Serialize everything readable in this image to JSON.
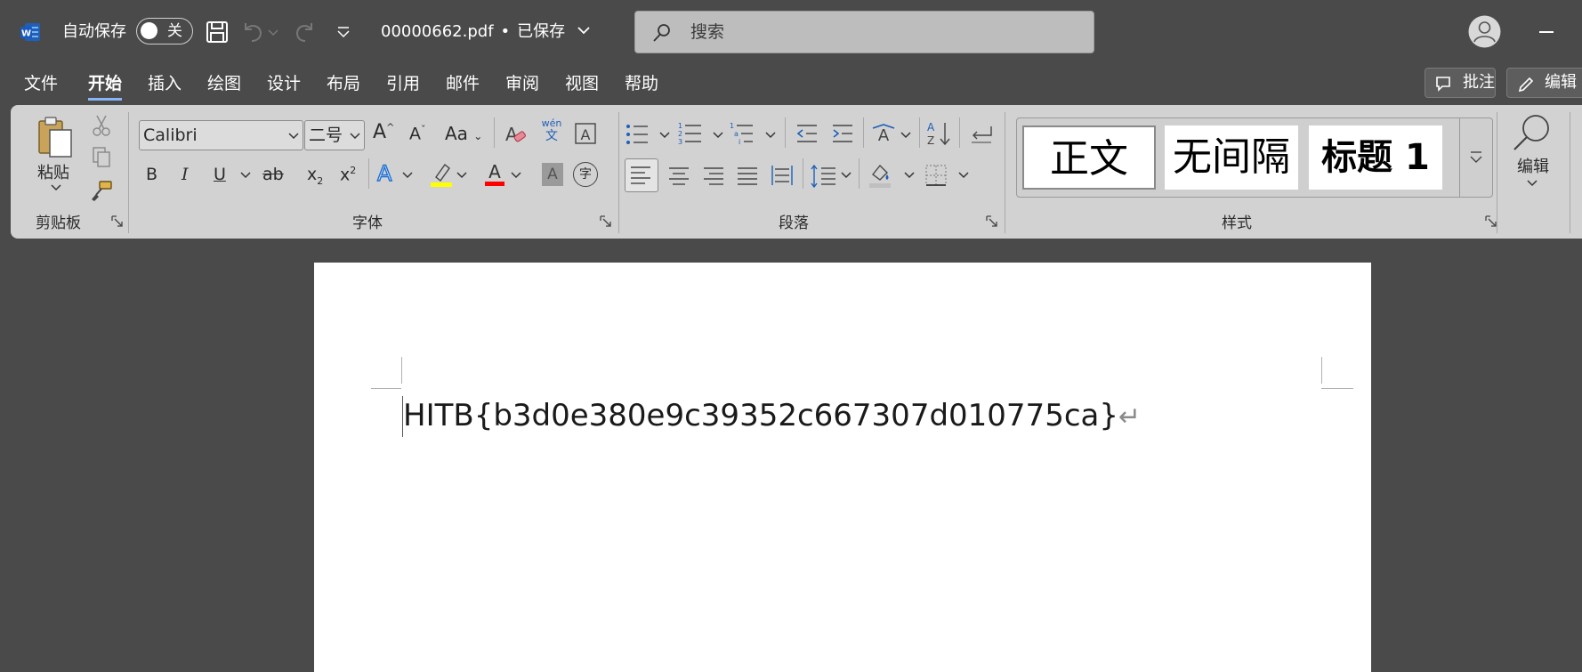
{
  "titlebar": {
    "autosave_label": "自动保存",
    "autosave_state": "关",
    "filename": "00000662.pdf",
    "separator": "•",
    "save_status": "已保存",
    "search_placeholder": "搜索"
  },
  "menu": {
    "tabs": [
      {
        "label": "文件"
      },
      {
        "label": "开始",
        "active": true
      },
      {
        "label": "插入"
      },
      {
        "label": "绘图"
      },
      {
        "label": "设计"
      },
      {
        "label": "布局"
      },
      {
        "label": "引用"
      },
      {
        "label": "邮件"
      },
      {
        "label": "审阅"
      },
      {
        "label": "视图"
      },
      {
        "label": "帮助"
      }
    ],
    "comments_label": "批注",
    "editing_label": "编辑"
  },
  "ribbon": {
    "clipboard": {
      "paste_label": "粘贴",
      "group_label": "剪贴板"
    },
    "font": {
      "font_name": "Calibri",
      "font_size": "二号",
      "group_label": "字体",
      "phonetic_top": "wén",
      "phonetic_bottom": "文",
      "change_case_label": "Aa",
      "bold_label": "B",
      "italic_label": "I",
      "underline_label": "U",
      "strike_label": "ab",
      "subscript_label": "x",
      "superscript_label": "x",
      "font_color_label": "A",
      "text_effects_label": "A",
      "char_shading_label": "A",
      "enclose_label": "字",
      "clear_format_label": "A",
      "grow_label": "A",
      "shrink_label": "A"
    },
    "paragraph": {
      "group_label": "段落"
    },
    "styles": {
      "items": [
        "正文",
        "无间隔",
        "标题 1"
      ],
      "group_label": "样式"
    },
    "editing": {
      "label": "编辑"
    }
  },
  "colors": {
    "highlight": "#ffff00",
    "font_color": "#ff0000",
    "text_effect": "#1f6fd1"
  },
  "document": {
    "text": "HITB{b3d0e380e9c39352c667307d010775ca}",
    "paragraph_mark": "↵"
  }
}
